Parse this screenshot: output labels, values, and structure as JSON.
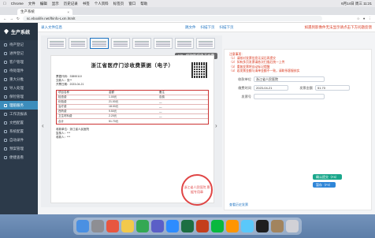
{
  "menubar": {
    "app": "Chrome",
    "items": [
      "文件",
      "编辑",
      "显示",
      "历史记录",
      "书签",
      "个人资料",
      "标签页",
      "窗口",
      "帮助"
    ],
    "right": [
      "6月14日 周三 11:21"
    ]
  },
  "browser": {
    "tab_title": "生产系统",
    "url": "sc.eboxlife.net/lhinfo-Lxm.htmlt"
  },
  "sidebar": {
    "brand": "生产系统",
    "items": [
      {
        "label": "待产登记",
        "active": false
      },
      {
        "label": "进件登记",
        "active": false
      },
      {
        "label": "客户管理",
        "active": false
      },
      {
        "label": "待处理件",
        "active": false
      },
      {
        "label": "重大分推",
        "active": false
      },
      {
        "label": "导入处理",
        "active": false
      },
      {
        "label": "保险管理",
        "active": false
      },
      {
        "label": "理赔服务",
        "active": true
      },
      {
        "label": "工作流报表",
        "active": false
      },
      {
        "label": "文档配置",
        "active": false
      },
      {
        "label": "系统配置",
        "active": false
      },
      {
        "label": "自动录件",
        "active": false
      },
      {
        "label": "预案管理",
        "active": false
      },
      {
        "label": "便捷查看",
        "active": false
      }
    ]
  },
  "topbar": {
    "page_title": "录入文件信息",
    "actions": [
      "跳文件",
      "扫描下页",
      "扫描下页"
    ],
    "hint": "如遇到影像件无法显示请点击下方问题反馈"
  },
  "viewer": {
    "counter": "1/3 - 缩放医疗电子发票",
    "invoice_title": "浙江省医疗门诊收费票据（电子）",
    "meta": [
      "票据代码：33890110",
      "交款人：张**",
      "开票日期：2023-04-21"
    ],
    "table_rows": [
      [
        "项目名称",
        "金额",
        "备注"
      ],
      [
        "检查费",
        "1.00元",
        "自费"
      ],
      [
        "化验费",
        "21.00元",
        "—"
      ],
      [
        "治疗费",
        "18.00元",
        "—"
      ],
      [
        "西药费",
        "9.50元",
        "—"
      ],
      [
        "卫生材料费",
        "2.20元",
        "—"
      ],
      [
        "合计",
        "51.70元",
        ""
      ]
    ],
    "foot": [
      "收款单位：浙江省人民医院",
      "复核人：***",
      "收款人：***"
    ],
    "stamp_text": "浙江省人民医院 票据专用章"
  },
  "panel": {
    "notes": [
      "注意事项：",
      "（1）请核对发票信息无误后再提交",
      "（2）如有多页发票请依次扫描后统一上传",
      "（3）重复发票将自动标记提醒",
      "（4）若发票金额与清单金额不一致，请联系客服核实"
    ],
    "fields": [
      {
        "label": "收款单位",
        "value": "浙江省人民医院"
      },
      {
        "label": "缴费时间",
        "value": "2023-04-21"
      },
      {
        "label": "发票金额",
        "value": "51.70"
      },
      {
        "label": "发票号",
        "value": ""
      }
    ],
    "btn_confirm": "确认提交（F8）",
    "btn_save": "暂存（F9）",
    "link_view": "查看历史发票"
  }
}
